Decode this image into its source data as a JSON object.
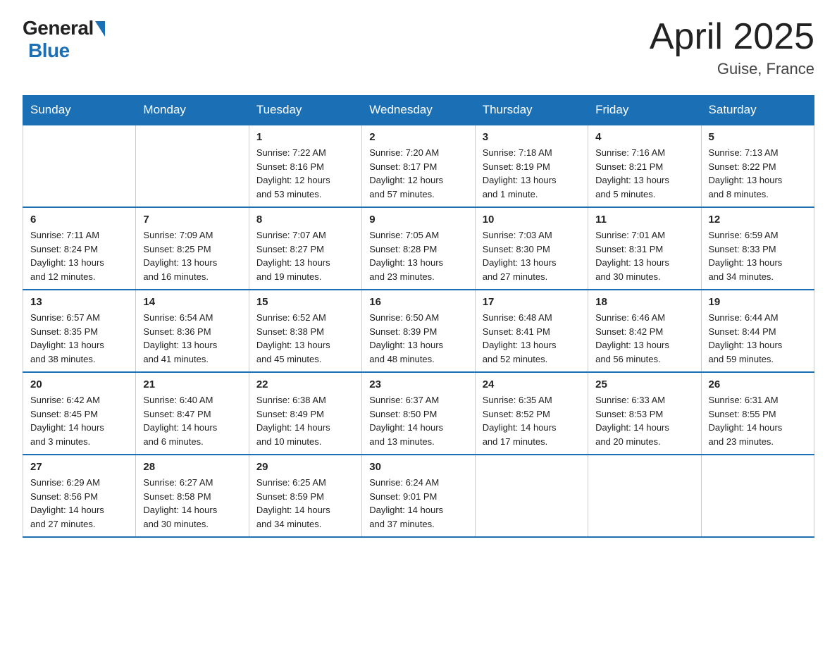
{
  "header": {
    "logo_general": "General",
    "logo_blue": "Blue",
    "month_title": "April 2025",
    "location": "Guise, France"
  },
  "weekdays": [
    "Sunday",
    "Monday",
    "Tuesday",
    "Wednesday",
    "Thursday",
    "Friday",
    "Saturday"
  ],
  "weeks": [
    [
      {
        "day": "",
        "detail": ""
      },
      {
        "day": "",
        "detail": ""
      },
      {
        "day": "1",
        "detail": "Sunrise: 7:22 AM\nSunset: 8:16 PM\nDaylight: 12 hours\nand 53 minutes."
      },
      {
        "day": "2",
        "detail": "Sunrise: 7:20 AM\nSunset: 8:17 PM\nDaylight: 12 hours\nand 57 minutes."
      },
      {
        "day": "3",
        "detail": "Sunrise: 7:18 AM\nSunset: 8:19 PM\nDaylight: 13 hours\nand 1 minute."
      },
      {
        "day": "4",
        "detail": "Sunrise: 7:16 AM\nSunset: 8:21 PM\nDaylight: 13 hours\nand 5 minutes."
      },
      {
        "day": "5",
        "detail": "Sunrise: 7:13 AM\nSunset: 8:22 PM\nDaylight: 13 hours\nand 8 minutes."
      }
    ],
    [
      {
        "day": "6",
        "detail": "Sunrise: 7:11 AM\nSunset: 8:24 PM\nDaylight: 13 hours\nand 12 minutes."
      },
      {
        "day": "7",
        "detail": "Sunrise: 7:09 AM\nSunset: 8:25 PM\nDaylight: 13 hours\nand 16 minutes."
      },
      {
        "day": "8",
        "detail": "Sunrise: 7:07 AM\nSunset: 8:27 PM\nDaylight: 13 hours\nand 19 minutes."
      },
      {
        "day": "9",
        "detail": "Sunrise: 7:05 AM\nSunset: 8:28 PM\nDaylight: 13 hours\nand 23 minutes."
      },
      {
        "day": "10",
        "detail": "Sunrise: 7:03 AM\nSunset: 8:30 PM\nDaylight: 13 hours\nand 27 minutes."
      },
      {
        "day": "11",
        "detail": "Sunrise: 7:01 AM\nSunset: 8:31 PM\nDaylight: 13 hours\nand 30 minutes."
      },
      {
        "day": "12",
        "detail": "Sunrise: 6:59 AM\nSunset: 8:33 PM\nDaylight: 13 hours\nand 34 minutes."
      }
    ],
    [
      {
        "day": "13",
        "detail": "Sunrise: 6:57 AM\nSunset: 8:35 PM\nDaylight: 13 hours\nand 38 minutes."
      },
      {
        "day": "14",
        "detail": "Sunrise: 6:54 AM\nSunset: 8:36 PM\nDaylight: 13 hours\nand 41 minutes."
      },
      {
        "day": "15",
        "detail": "Sunrise: 6:52 AM\nSunset: 8:38 PM\nDaylight: 13 hours\nand 45 minutes."
      },
      {
        "day": "16",
        "detail": "Sunrise: 6:50 AM\nSunset: 8:39 PM\nDaylight: 13 hours\nand 48 minutes."
      },
      {
        "day": "17",
        "detail": "Sunrise: 6:48 AM\nSunset: 8:41 PM\nDaylight: 13 hours\nand 52 minutes."
      },
      {
        "day": "18",
        "detail": "Sunrise: 6:46 AM\nSunset: 8:42 PM\nDaylight: 13 hours\nand 56 minutes."
      },
      {
        "day": "19",
        "detail": "Sunrise: 6:44 AM\nSunset: 8:44 PM\nDaylight: 13 hours\nand 59 minutes."
      }
    ],
    [
      {
        "day": "20",
        "detail": "Sunrise: 6:42 AM\nSunset: 8:45 PM\nDaylight: 14 hours\nand 3 minutes."
      },
      {
        "day": "21",
        "detail": "Sunrise: 6:40 AM\nSunset: 8:47 PM\nDaylight: 14 hours\nand 6 minutes."
      },
      {
        "day": "22",
        "detail": "Sunrise: 6:38 AM\nSunset: 8:49 PM\nDaylight: 14 hours\nand 10 minutes."
      },
      {
        "day": "23",
        "detail": "Sunrise: 6:37 AM\nSunset: 8:50 PM\nDaylight: 14 hours\nand 13 minutes."
      },
      {
        "day": "24",
        "detail": "Sunrise: 6:35 AM\nSunset: 8:52 PM\nDaylight: 14 hours\nand 17 minutes."
      },
      {
        "day": "25",
        "detail": "Sunrise: 6:33 AM\nSunset: 8:53 PM\nDaylight: 14 hours\nand 20 minutes."
      },
      {
        "day": "26",
        "detail": "Sunrise: 6:31 AM\nSunset: 8:55 PM\nDaylight: 14 hours\nand 23 minutes."
      }
    ],
    [
      {
        "day": "27",
        "detail": "Sunrise: 6:29 AM\nSunset: 8:56 PM\nDaylight: 14 hours\nand 27 minutes."
      },
      {
        "day": "28",
        "detail": "Sunrise: 6:27 AM\nSunset: 8:58 PM\nDaylight: 14 hours\nand 30 minutes."
      },
      {
        "day": "29",
        "detail": "Sunrise: 6:25 AM\nSunset: 8:59 PM\nDaylight: 14 hours\nand 34 minutes."
      },
      {
        "day": "30",
        "detail": "Sunrise: 6:24 AM\nSunset: 9:01 PM\nDaylight: 14 hours\nand 37 minutes."
      },
      {
        "day": "",
        "detail": ""
      },
      {
        "day": "",
        "detail": ""
      },
      {
        "day": "",
        "detail": ""
      }
    ]
  ]
}
